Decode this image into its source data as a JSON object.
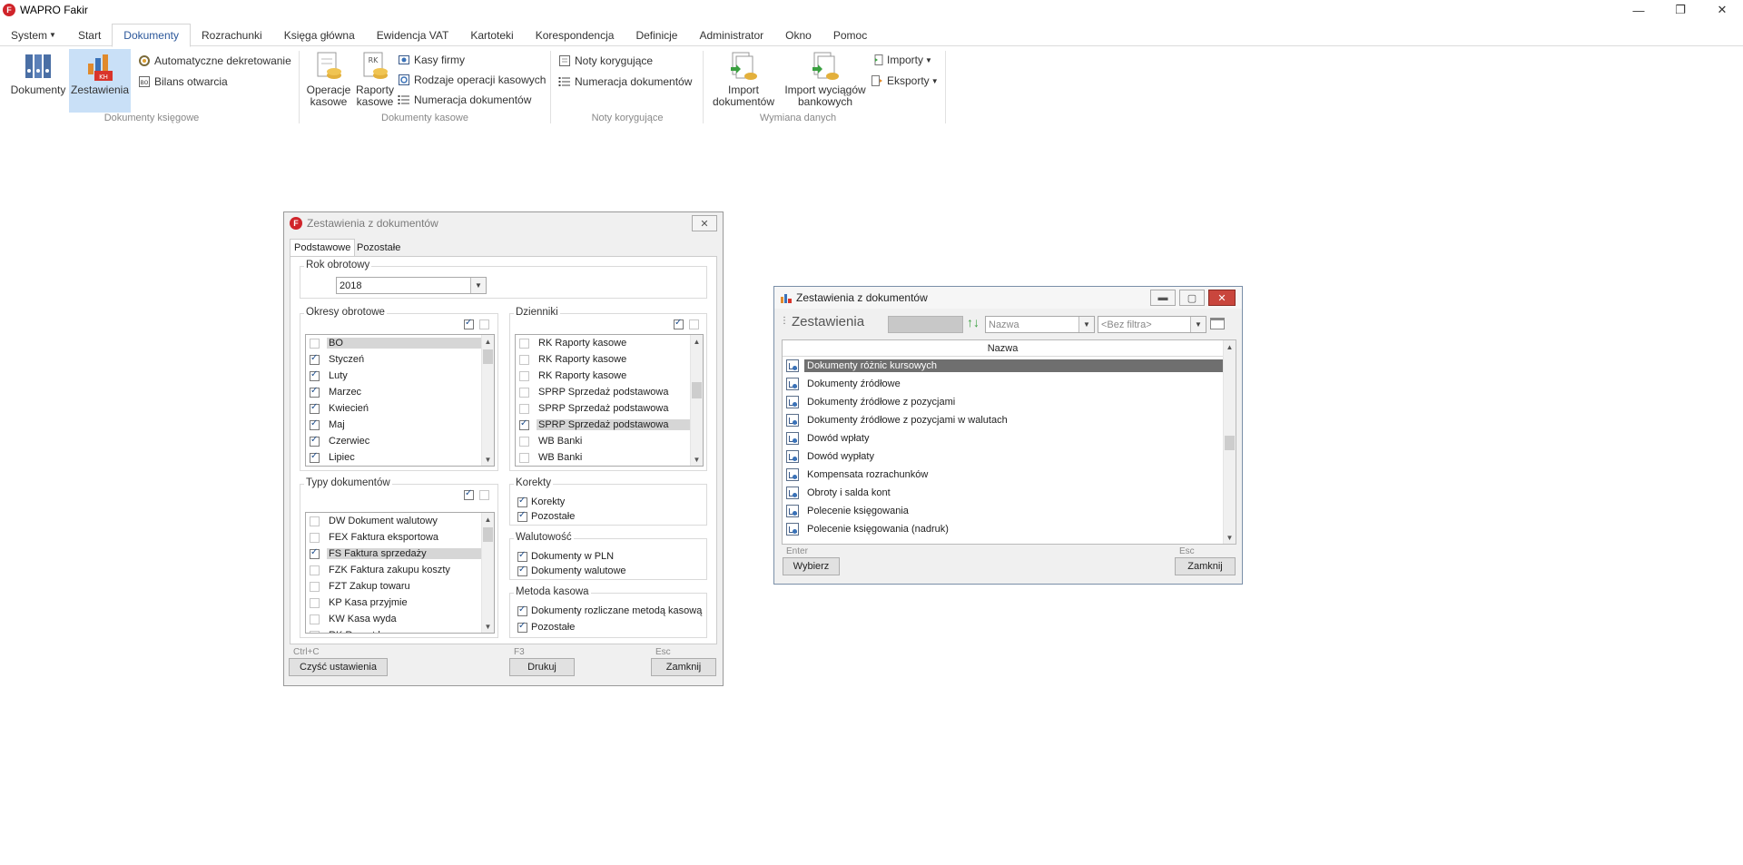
{
  "app": {
    "title": "WAPRO Fakir",
    "logo_letter": "F"
  },
  "window_controls": {
    "minimize": "—",
    "restore": "❐",
    "close": "✕"
  },
  "menu": {
    "items": [
      "System",
      "Start",
      "Dokumenty",
      "Rozrachunki",
      "Księga główna",
      "Ewidencja VAT",
      "Kartoteki",
      "Korespondencja",
      "Definicje",
      "Administrator",
      "Okno",
      "Pomoc"
    ],
    "active": "Dokumenty"
  },
  "ribbon": {
    "groups": {
      "ksiegowe": {
        "label": "Dokumenty księgowe",
        "dokumenty": "Dokumenty",
        "zestawienia": "Zestawienia",
        "auto_dekret": "Automatyczne dekretowanie",
        "bilans": "Bilans otwarcia"
      },
      "kasowe": {
        "label": "Dokumenty kasowe",
        "operacje_1": "Operacje",
        "operacje_2": "kasowe",
        "raporty_1": "Raporty",
        "raporty_2": "kasowe",
        "kasy": "Kasy firmy",
        "rodzaje": "Rodzaje operacji kasowych",
        "numeracja": "Numeracja dokumentów"
      },
      "noty": {
        "label": "Noty korygujące",
        "noty": "Noty korygujące",
        "numeracja": "Numeracja dokumentów"
      },
      "wymiana": {
        "label": "Wymiana danych",
        "import_1": "Import",
        "import_2": "dokumentów",
        "wyciagi_1": "Import wyciągów",
        "wyciagi_2": "bankowych",
        "importy": "Importy",
        "eksporty": "Eksporty"
      }
    }
  },
  "dialog1": {
    "title": "Zestawienia z dokumentów",
    "tabs": [
      "Podstawowe",
      "Pozostałe"
    ],
    "rok": {
      "label": "Rok obrotowy",
      "value": "2018"
    },
    "okresy": {
      "label": "Okresy obrotowe",
      "items": [
        {
          "text": "BO",
          "checked": false,
          "selected": true
        },
        {
          "text": "Styczeń",
          "checked": true,
          "selected": false
        },
        {
          "text": "Luty",
          "checked": true,
          "selected": false
        },
        {
          "text": "Marzec",
          "checked": true,
          "selected": false
        },
        {
          "text": "Kwiecień",
          "checked": true,
          "selected": false
        },
        {
          "text": "Maj",
          "checked": true,
          "selected": false
        },
        {
          "text": "Czerwiec",
          "checked": true,
          "selected": false
        },
        {
          "text": "Lipiec",
          "checked": true,
          "selected": false
        }
      ]
    },
    "dzienniki": {
      "label": "Dzienniki",
      "items": [
        {
          "text": "RK Raporty kasowe",
          "checked": false,
          "selected": false
        },
        {
          "text": "RK Raporty kasowe",
          "checked": false,
          "selected": false
        },
        {
          "text": "RK Raporty kasowe",
          "checked": false,
          "selected": false
        },
        {
          "text": "SPRP Sprzedaż podstawowa",
          "checked": false,
          "selected": false
        },
        {
          "text": "SPRP Sprzedaż podstawowa",
          "checked": false,
          "selected": false
        },
        {
          "text": "SPRP Sprzedaż podstawowa",
          "checked": true,
          "selected": true
        },
        {
          "text": "WB Banki",
          "checked": false,
          "selected": false
        },
        {
          "text": "WB Banki",
          "checked": false,
          "selected": false
        }
      ]
    },
    "typy": {
      "label": "Typy dokumentów",
      "items": [
        {
          "text": "DW Dokument walutowy",
          "checked": false,
          "selected": false
        },
        {
          "text": "FEX Faktura eksportowa",
          "checked": false,
          "selected": false
        },
        {
          "text": "FS Faktura sprzedaży",
          "checked": true,
          "selected": true
        },
        {
          "text": "FZK Faktura zakupu koszty",
          "checked": false,
          "selected": false
        },
        {
          "text": "FZT Zakup towaru",
          "checked": false,
          "selected": false
        },
        {
          "text": "KP Kasa przyjmie",
          "checked": false,
          "selected": false
        },
        {
          "text": "KW Kasa wyda",
          "checked": false,
          "selected": false
        },
        {
          "text": "RK Raport kasowy",
          "checked": false,
          "selected": false
        }
      ]
    },
    "korekty": {
      "label": "Korekty",
      "opt1": "Korekty",
      "opt2": "Pozostałe"
    },
    "walutowosc": {
      "label": "Walutowość",
      "opt1": "Dokumenty w PLN",
      "opt2": "Dokumenty walutowe"
    },
    "metoda": {
      "label": "Metoda kasowa",
      "opt1": "Dokumenty rozliczane metodą kasową",
      "opt2": "Pozostałe"
    },
    "footer": {
      "clear_shortcut": "Ctrl+C",
      "clear_label": "Czyść ustawienia",
      "print_shortcut": "F3",
      "print_label": "Drukuj",
      "close_shortcut": "Esc",
      "close_label": "Zamknij"
    }
  },
  "dialog2": {
    "title": "Zestawienia z dokumentów",
    "header": "Zestawienia",
    "sort_field": "Nazwa",
    "filter": "<Bez filtra>",
    "column": "Nazwa",
    "rows": [
      "Dokumenty różnic kursowych",
      "Dokumenty źródłowe",
      "Dokumenty źródłowe z pozycjami",
      "Dokumenty źródłowe z pozycjami w walutach",
      "Dowód wpłaty",
      "Dowód wypłaty",
      "Kompensata rozrachunków",
      "Obroty i salda kont",
      "Polecenie księgowania",
      "Polecenie księgowania (nadruk)"
    ],
    "selected_index": 0,
    "footer": {
      "choose_shortcut": "Enter",
      "choose_label": "Wybierz",
      "close_shortcut": "Esc",
      "close_label": "Zamknij"
    }
  },
  "colors": {
    "accent": "#2b579a",
    "ribbon_selected": "#c9e0f7",
    "logo_red": "#d0242a"
  }
}
